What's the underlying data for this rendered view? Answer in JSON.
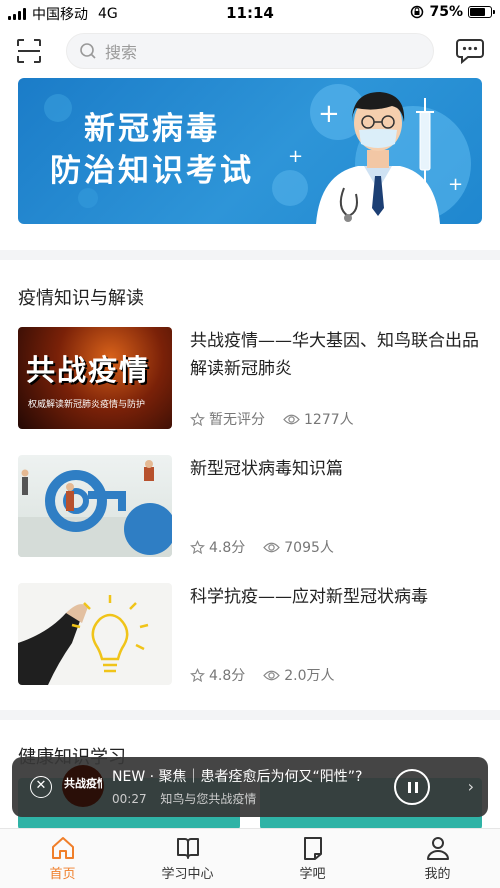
{
  "status_bar": {
    "carrier": "中国移动",
    "network": "4G",
    "time": "11:14",
    "battery": "75%",
    "battery_level": 0.75
  },
  "top_bar": {
    "search_placeholder": "搜索",
    "scan_icon": "scan-icon",
    "message_icon": "message-icon"
  },
  "banner": {
    "line1": "新冠病毒",
    "line2": "防治知识考试"
  },
  "sections": [
    {
      "title": "疫情知识与解读",
      "courses": [
        {
          "title": "共战疫情——华大基因、知鸟联合出品解读新冠肺炎",
          "rating": "暂无评分",
          "learners": "1277人",
          "thumb_title": "共战疫情",
          "thumb_subtitle": "权威解读新冠肺炎疫情与防护"
        },
        {
          "title": "新型冠状病毒知识篇",
          "rating": "4.8分",
          "learners": "7095人"
        },
        {
          "title": "科学抗疫——应对新型冠状病毒",
          "rating": "4.8分",
          "learners": "2.0万人"
        }
      ]
    },
    {
      "title": "健康知识学习"
    }
  ],
  "player": {
    "title": "NEW · 聚焦｜患者痊愈后为何又“阳性”?",
    "time": "00:27",
    "subtitle": "知鸟与您共战疫情",
    "cover_text": "共战疫情"
  },
  "tabs": [
    {
      "label": "首页",
      "icon": "home-icon",
      "active": true
    },
    {
      "label": "学习中心",
      "icon": "book-icon",
      "active": false
    },
    {
      "label": "学吧",
      "icon": "note-icon",
      "active": false
    },
    {
      "label": "我的",
      "icon": "user-icon",
      "active": false
    }
  ],
  "colors": {
    "accent": "#f07f2a",
    "banner_blue": "#2e95d8"
  }
}
